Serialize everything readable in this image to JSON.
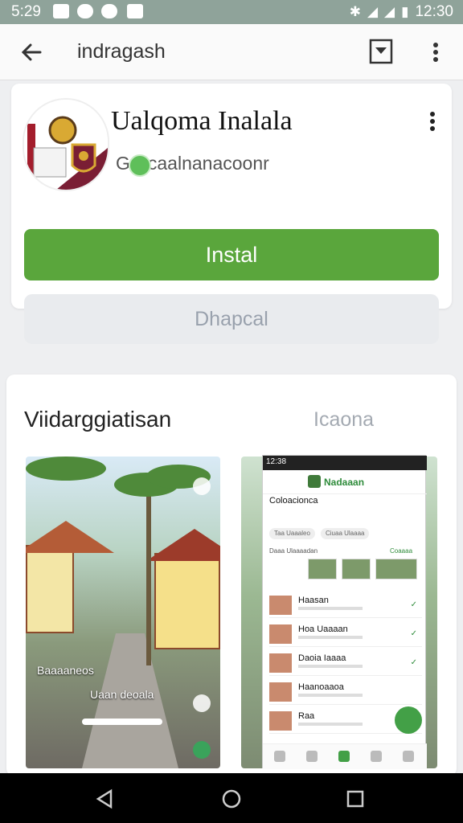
{
  "status_bar": {
    "time_left": "5:29",
    "time_right": "12:30",
    "icons": [
      "gallery-icon",
      "face-icon",
      "record-icon",
      "message-icon",
      "bluetooth-icon",
      "signal-icon",
      "wifi-icon",
      "battery-icon"
    ]
  },
  "app_bar": {
    "title": "indragash",
    "back_icon": "arrow-left-icon",
    "bookmark_icon": "bookmark-icon",
    "menu_icon": "more-vert-icon"
  },
  "app": {
    "name": "Ualqoma Inalala",
    "developer": "caalnanacoonr",
    "developer_prefix": "G",
    "install_label": "Instal",
    "secondary_label": "Dhapcal",
    "colors": {
      "accent": "#5aa63c",
      "secondary_bg": "#e9ebee"
    }
  },
  "screenshots_section": {
    "title": "Viidarggiatisan",
    "tab": "Icaona",
    "shot1": {
      "caption_top": "Baaaaneos",
      "caption_mid": "Uaan deoala"
    },
    "shot2": {
      "status_time": "12:38",
      "header": "Nadaaan",
      "app_name": "Coloacionca",
      "chips": [
        "Taa Uaaaleo",
        "Ciuaa Ulaaaa"
      ],
      "section_label": "Daaa Ulaaaadan",
      "section_link": "Coaaaa",
      "rows": [
        {
          "name": "Haasan"
        },
        {
          "name": "Hoa Uaaaan"
        },
        {
          "name": "Daoia Iaaaa"
        },
        {
          "name": "Haanoaaoa"
        },
        {
          "name": "Raa"
        }
      ]
    }
  },
  "nav_bar": {
    "icons": [
      "back-triangle-icon",
      "home-circle-icon",
      "recents-square-icon"
    ]
  }
}
